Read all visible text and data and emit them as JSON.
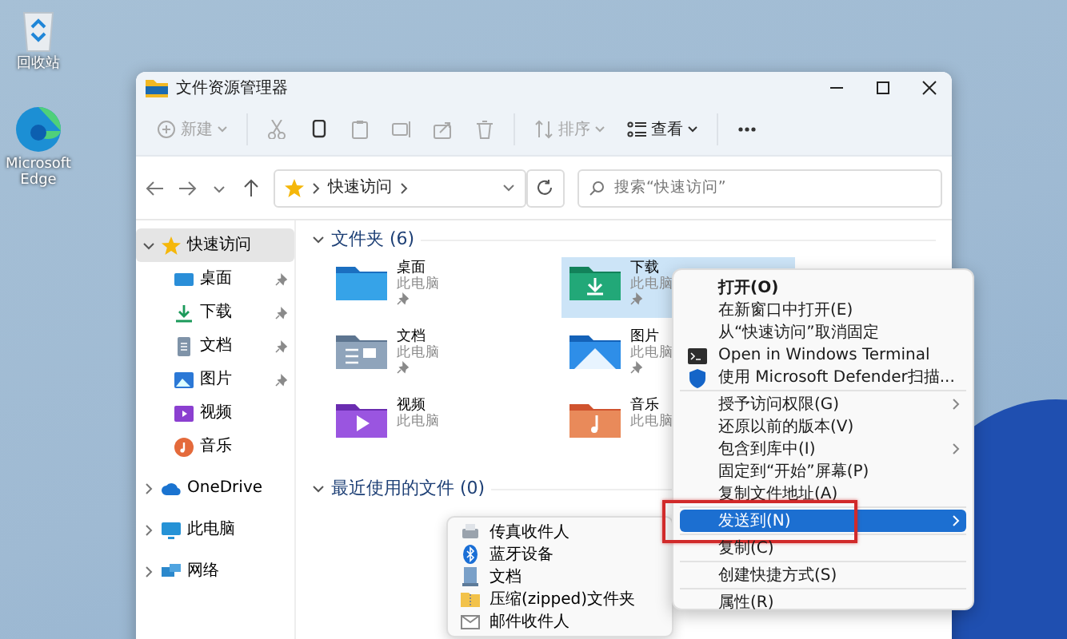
{
  "desktop_icons": [
    {
      "label": "回收站",
      "kind": "recycle"
    },
    {
      "label": "Microsoft Edge",
      "kind": "edge"
    }
  ],
  "window": {
    "title": "文件资源管理器"
  },
  "toolbar": [
    {
      "kind": "new",
      "label": "新建",
      "dropdown": true,
      "disabled": true
    },
    {
      "kind": "cut",
      "disabled": true
    },
    {
      "kind": "copy",
      "disabled": false
    },
    {
      "kind": "paste",
      "disabled": true
    },
    {
      "kind": "rename",
      "disabled": true
    },
    {
      "kind": "share",
      "disabled": true
    },
    {
      "kind": "delete",
      "disabled": true
    },
    {
      "kind": "sort",
      "label": "排序",
      "dropdown": true,
      "disabled": true
    },
    {
      "kind": "view",
      "label": "查看",
      "dropdown": true,
      "disabled": false
    },
    {
      "kind": "more",
      "disabled": false
    }
  ],
  "address": {
    "path": [
      "快速访问"
    ],
    "search_placeholder": "搜索“快速访问”"
  },
  "nav_pane": [
    {
      "label": "快速访问",
      "kind": "star",
      "expanded": true,
      "selected": true,
      "children": [
        {
          "label": "桌面",
          "kind": "desktop",
          "pinned": true
        },
        {
          "label": "下载",
          "kind": "download",
          "pinned": true
        },
        {
          "label": "文档",
          "kind": "document",
          "pinned": true
        },
        {
          "label": "图片",
          "kind": "picture",
          "pinned": true
        },
        {
          "label": "视频",
          "kind": "video",
          "pinned": false
        },
        {
          "label": "音乐",
          "kind": "music",
          "pinned": false
        }
      ]
    },
    {
      "label": "OneDrive",
      "kind": "cloud",
      "expanded": false,
      "selected": false
    },
    {
      "label": "此电脑",
      "kind": "pc",
      "expanded": false,
      "selected": false
    },
    {
      "label": "网络",
      "kind": "network",
      "expanded": false,
      "selected": false
    }
  ],
  "sections": [
    {
      "title": "文件夹 (6)",
      "expanded": true,
      "folders": [
        {
          "name": "桌面",
          "location": "此电脑",
          "kind": "desktop",
          "pinned": true,
          "selected": false
        },
        {
          "name": "下载",
          "location": "此电脑",
          "kind": "download",
          "pinned": true,
          "selected": true
        },
        {
          "name": "文档",
          "location": "此电脑",
          "kind": "document",
          "pinned": true,
          "selected": false
        },
        {
          "name": "图片",
          "location": "此电脑",
          "kind": "picture",
          "pinned": true,
          "selected": false
        },
        {
          "name": "视频",
          "location": "此电脑",
          "kind": "video",
          "pinned": false,
          "selected": false
        },
        {
          "name": "音乐",
          "location": "此电脑",
          "kind": "music",
          "pinned": false,
          "selected": false
        }
      ]
    },
    {
      "title": "最近使用的文件 (0)",
      "expanded": true
    }
  ],
  "context_menu": [
    {
      "kind": "item",
      "label": "打开(O)",
      "bold": true,
      "selected": false
    },
    {
      "kind": "item",
      "label": "在新窗口中打开(E)",
      "selected": false
    },
    {
      "kind": "item",
      "label": "从“快速访问”取消固定",
      "selected": false
    },
    {
      "kind": "item",
      "label": "Open in Windows Terminal",
      "selected": false
    },
    {
      "kind": "item",
      "label": "使用 Microsoft Defender扫描...",
      "selected": false
    },
    {
      "kind": "separator"
    },
    {
      "kind": "item",
      "label": "授予访问权限(G)",
      "submenu": true,
      "selected": false
    },
    {
      "kind": "item",
      "label": "还原以前的版本(V)",
      "selected": false
    },
    {
      "kind": "item",
      "label": "包含到库中(I)",
      "submenu": true,
      "selected": false
    },
    {
      "kind": "item",
      "label": "固定到“开始”屏幕(P)",
      "selected": false
    },
    {
      "kind": "item",
      "label": "复制文件地址(A)",
      "selected": false
    },
    {
      "kind": "separator"
    },
    {
      "kind": "item",
      "label": "发送到(N)",
      "submenu": true,
      "selected": true,
      "annotated": true
    },
    {
      "kind": "separator"
    },
    {
      "kind": "item",
      "label": "复制(C)",
      "selected": false
    },
    {
      "kind": "separator"
    },
    {
      "kind": "item",
      "label": "创建快捷方式(S)",
      "selected": false
    },
    {
      "kind": "separator"
    },
    {
      "kind": "item",
      "label": "属性(R)",
      "selected": false
    }
  ],
  "send_to_menu": [
    {
      "label": "传真收件人"
    },
    {
      "label": "蓝牙设备"
    },
    {
      "label": "文档"
    },
    {
      "label": "压缩(zipped)文件夹"
    },
    {
      "label": "邮件收件人"
    }
  ]
}
